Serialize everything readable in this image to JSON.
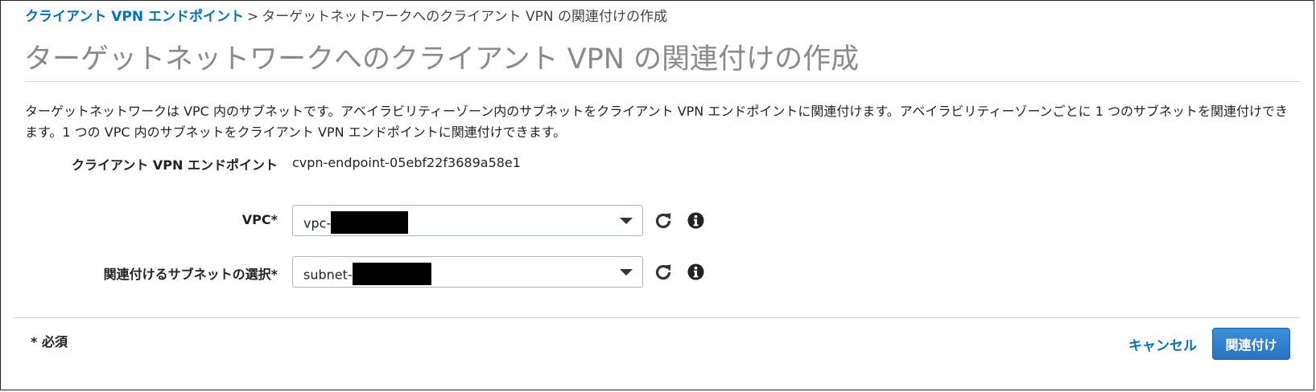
{
  "breadcrumb": {
    "parent_label": "クライアント VPN エンドポイント",
    "separator": ">",
    "current_label": "ターゲットネットワークへのクライアント VPN の関連付けの作成"
  },
  "page": {
    "title": "ターゲットネットワークへのクライアント VPN の関連付けの作成",
    "description": "ターゲットネットワークは VPC 内のサブネットです。アベイラビリティーゾーン内のサブネットをクライアント VPN エンドポイントに関連付けます。アベイラビリティーゾーンごとに 1 つのサブネットを関連付けできます。1 つの VPC 内のサブネットをクライアント VPN エンドポイントに関連付けできます。"
  },
  "form": {
    "endpoint": {
      "label": "クライアント VPN エンドポイント",
      "value": "cvpn-endpoint-05ebf22f3689a58e1"
    },
    "vpc": {
      "label": "VPC*",
      "value_prefix": "vpc-",
      "redacted": true
    },
    "subnet": {
      "label": "関連付けるサブネットの選択*",
      "value_prefix": "subnet-",
      "redacted": true
    }
  },
  "footer": {
    "required_note": "* 必須",
    "cancel_label": "キャンセル",
    "submit_label": "関連付け"
  },
  "icons": {
    "refresh": "refresh-icon",
    "info": "info-icon",
    "dropdown": "chevron-down-icon"
  },
  "colors": {
    "link": "#0073bb",
    "primary_button": "#2a72c4",
    "title_gray": "#8a8a8a",
    "redaction": "#000000"
  }
}
